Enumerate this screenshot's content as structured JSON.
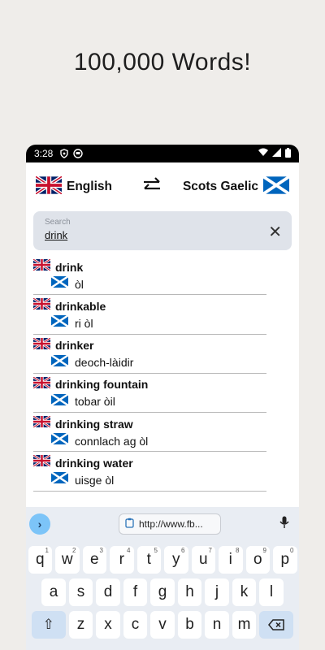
{
  "headline": "100,000 Words!",
  "status": {
    "time": "3:28"
  },
  "langbar": {
    "source": "English",
    "target": "Scots Gaelic"
  },
  "search": {
    "placeholder": "Search",
    "value": "drink"
  },
  "entries": [
    {
      "word": "drink",
      "translation": "òl"
    },
    {
      "word": "drinkable",
      "translation": "ri òl"
    },
    {
      "word": "drinker",
      "translation": "deoch-làidir"
    },
    {
      "word": "drinking fountain",
      "translation": "tobar òil"
    },
    {
      "word": "drinking straw",
      "translation": "connlach ag òl"
    },
    {
      "word": "drinking water",
      "translation": "uisge òl"
    }
  ],
  "keyboard": {
    "url_suggestion": "http://www.fb...",
    "row1": [
      {
        "k": "q",
        "h": "1"
      },
      {
        "k": "w",
        "h": "2"
      },
      {
        "k": "e",
        "h": "3"
      },
      {
        "k": "r",
        "h": "4"
      },
      {
        "k": "t",
        "h": "5"
      },
      {
        "k": "y",
        "h": "6"
      },
      {
        "k": "u",
        "h": "7"
      },
      {
        "k": "i",
        "h": "8"
      },
      {
        "k": "o",
        "h": "9"
      },
      {
        "k": "p",
        "h": "0"
      }
    ],
    "row2": [
      "a",
      "s",
      "d",
      "f",
      "g",
      "h",
      "j",
      "k",
      "l"
    ],
    "row3": [
      "z",
      "x",
      "c",
      "v",
      "b",
      "n",
      "m"
    ]
  },
  "colors": {
    "accent": "#7cc4f8",
    "search_bg": "#dfe3ea",
    "keyboard_bg": "#e9edf3"
  }
}
